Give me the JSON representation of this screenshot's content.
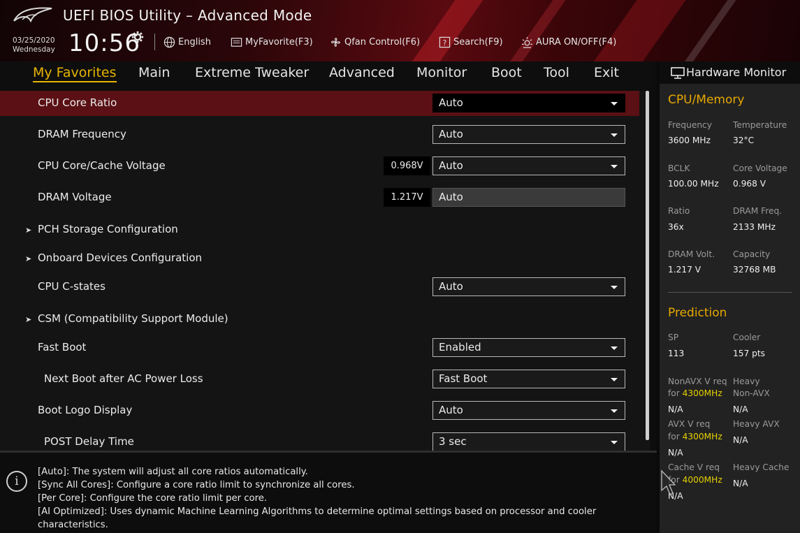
{
  "header": {
    "title": "UEFI BIOS Utility – Advanced Mode",
    "date": "03/25/2020",
    "day": "Wednesday",
    "time": "10:56",
    "buttons": [
      {
        "label": "English",
        "icon": "globe-icon"
      },
      {
        "label": "MyFavorite(F3)",
        "icon": "favorite-icon"
      },
      {
        "label": "Qfan Control(F6)",
        "icon": "fan-icon"
      },
      {
        "label": "Search(F9)",
        "icon": "search-icon"
      },
      {
        "label": "AURA ON/OFF(F4)",
        "icon": "aura-icon"
      }
    ]
  },
  "tabs": [
    {
      "label": "My Favorites",
      "active": true
    },
    {
      "label": "Main"
    },
    {
      "label": "Extreme Tweaker"
    },
    {
      "label": "Advanced"
    },
    {
      "label": "Monitor"
    },
    {
      "label": "Boot"
    },
    {
      "label": "Tool"
    },
    {
      "label": "Exit"
    }
  ],
  "settings": [
    {
      "label": "CPU Core Ratio",
      "value": "Auto",
      "selected": true
    },
    {
      "label": "DRAM Frequency",
      "value": "Auto"
    },
    {
      "label": "CPU Core/Cache Voltage",
      "voltage": "0.968V",
      "value": "Auto"
    },
    {
      "label": "DRAM Voltage",
      "voltage": "1.217V",
      "value": "Auto"
    },
    {
      "label": "PCH Storage Configuration",
      "submenu": true
    },
    {
      "label": "Onboard Devices Configuration",
      "submenu": true
    },
    {
      "label": "CPU C-states",
      "value": "Auto"
    },
    {
      "label": "CSM (Compatibility Support Module)",
      "submenu": true
    },
    {
      "label": "Fast Boot",
      "value": "Enabled"
    },
    {
      "label": "Next Boot after AC Power Loss",
      "value": "Fast Boot"
    },
    {
      "label": "Boot Logo Display",
      "value": "Auto"
    },
    {
      "label": "POST Delay Time",
      "value": "3 sec"
    }
  ],
  "help": [
    "[Auto]: The system will adjust all core ratios automatically.",
    "[Sync All Cores]: Configure a core ratio limit to synchronize all cores.",
    "[Per Core]: Configure the core ratio limit per core.",
    "[AI Optimized]: Uses dynamic Machine Learning Algorithms to determine optimal settings based on processor and cooler",
    "characteristics."
  ],
  "hardware_monitor": {
    "title": "Hardware Monitor",
    "cpu_memory": {
      "heading": "CPU/Memory",
      "frequency": {
        "label": "Frequency",
        "value": "3600 MHz"
      },
      "temperature": {
        "label": "Temperature",
        "value": "32°C"
      },
      "bclk": {
        "label": "BCLK",
        "value": "100.00 MHz"
      },
      "core_voltage": {
        "label": "Core Voltage",
        "value": "0.968 V"
      },
      "ratio": {
        "label": "Ratio",
        "value": "36x"
      },
      "dram_freq": {
        "label": "DRAM Freq.",
        "value": "2133 MHz"
      },
      "dram_volt": {
        "label": "DRAM Volt.",
        "value": "1.217 V"
      },
      "capacity": {
        "label": "Capacity",
        "value": "32768 MB"
      }
    },
    "prediction": {
      "heading": "Prediction",
      "sp": {
        "label": "SP",
        "value": "113"
      },
      "cooler": {
        "label": "Cooler",
        "value": "157 pts"
      },
      "nonavx": {
        "label": "NonAVX V req",
        "for": "for",
        "freq": "4300MHz",
        "value": "N/A"
      },
      "heavy_nonavx": {
        "label": "Heavy",
        "label2": "Non-AVX",
        "value": "N/A"
      },
      "avx": {
        "label": "AVX V req",
        "for": "for",
        "freq": "4300MHz",
        "value": "N/A"
      },
      "heavy_avx": {
        "label": "Heavy AVX",
        "value": "N/A"
      },
      "cache": {
        "label": "Cache V req",
        "for": "for",
        "freq": "4000MHz",
        "value": "N/A"
      },
      "heavy_cache": {
        "label": "Heavy Cache",
        "value": "N/A"
      }
    }
  },
  "colors": {
    "accent": "#e7b400",
    "selected_row": "#5a1014",
    "highlight_freq": "#e7d200"
  }
}
